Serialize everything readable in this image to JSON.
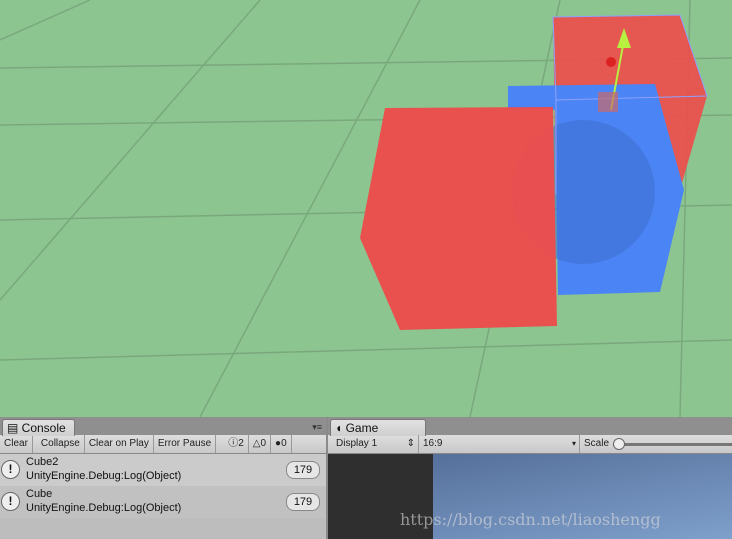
{
  "scene": {
    "background": "#8cc590",
    "colors": {
      "red": "#ee4b4b",
      "blue": "#4b84f4"
    }
  },
  "console": {
    "tab_label": "Console",
    "toolbar": {
      "clear": "Clear",
      "collapse": "Collapse",
      "clear_on_play": "Clear on Play",
      "error_pause": "Error Pause",
      "log_count": "2",
      "warning_count": "0",
      "error_count": "0"
    },
    "entries": [
      {
        "title": "Cube2",
        "detail": "UnityEngine.Debug:Log(Object)",
        "count": "179",
        "icon": "info-icon"
      },
      {
        "title": "Cube",
        "detail": "UnityEngine.Debug:Log(Object)",
        "count": "179",
        "icon": "info-icon"
      }
    ]
  },
  "game": {
    "tab_label": "Game",
    "display": "Display 1",
    "aspect": "16:9",
    "scale_label": "Scale"
  },
  "watermark": "https://blog.csdn.net/liaoshengg"
}
